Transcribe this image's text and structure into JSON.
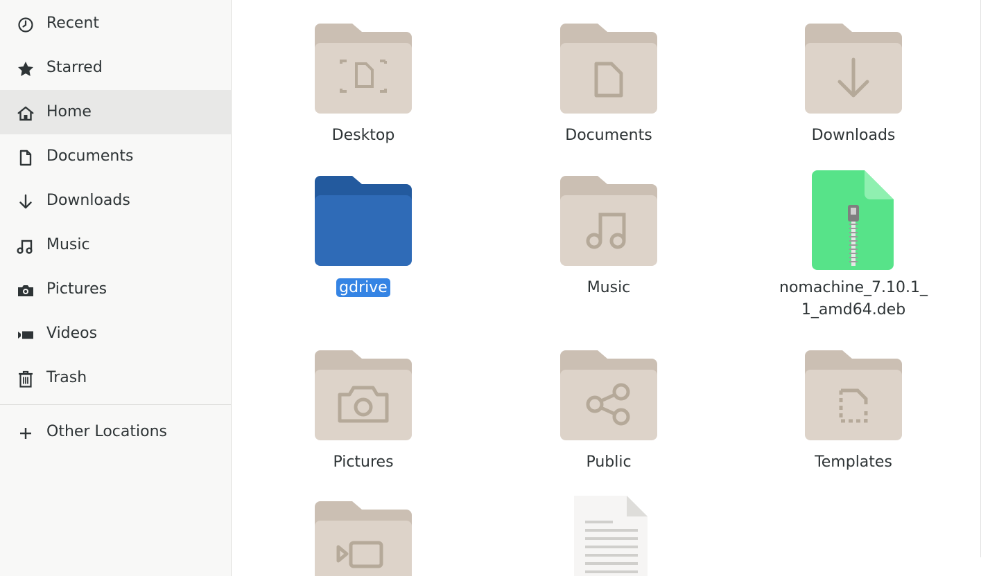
{
  "sidebar": {
    "items": [
      {
        "label": "Recent",
        "icon": "clock-icon"
      },
      {
        "label": "Starred",
        "icon": "star-icon"
      },
      {
        "label": "Home",
        "icon": "home-icon",
        "active": true
      },
      {
        "label": "Documents",
        "icon": "document-icon"
      },
      {
        "label": "Downloads",
        "icon": "download-arrow-icon"
      },
      {
        "label": "Music",
        "icon": "music-note-icon"
      },
      {
        "label": "Pictures",
        "icon": "camera-icon"
      },
      {
        "label": "Videos",
        "icon": "video-camera-icon"
      },
      {
        "label": "Trash",
        "icon": "trash-icon"
      }
    ],
    "other_locations": {
      "label": "Other Locations",
      "icon": "plus-icon"
    }
  },
  "files": [
    {
      "name": "Desktop",
      "type": "folder",
      "emblem": "desktop-icon"
    },
    {
      "name": "Documents",
      "type": "folder",
      "emblem": "document-icon"
    },
    {
      "name": "Downloads",
      "type": "folder",
      "emblem": "download-arrow-icon"
    },
    {
      "name": "gdrive",
      "type": "folder",
      "selected": true,
      "color": "#2a65b0"
    },
    {
      "name": "Music",
      "type": "folder",
      "emblem": "music-note-icon"
    },
    {
      "name": "nomachine_7.10.1_",
      "name_line2": "1_amd64.deb",
      "type": "archive",
      "color": "#57e389"
    },
    {
      "name": "Pictures",
      "type": "folder",
      "emblem": "camera-icon"
    },
    {
      "name": "Public",
      "type": "folder",
      "emblem": "share-icon"
    },
    {
      "name": "Templates",
      "type": "folder",
      "emblem": "template-icon"
    },
    {
      "name": "",
      "type": "folder",
      "emblem": "video-camera-icon"
    },
    {
      "name": "",
      "type": "text-file"
    }
  ],
  "colors": {
    "folder_back": "#cbbfb3",
    "folder_front": "#ddd3c9",
    "folder_emblem": "#b5a999",
    "selection": "#3584e4",
    "gdrive_back": "#235a9e",
    "gdrive_front": "#2f6bb7"
  }
}
